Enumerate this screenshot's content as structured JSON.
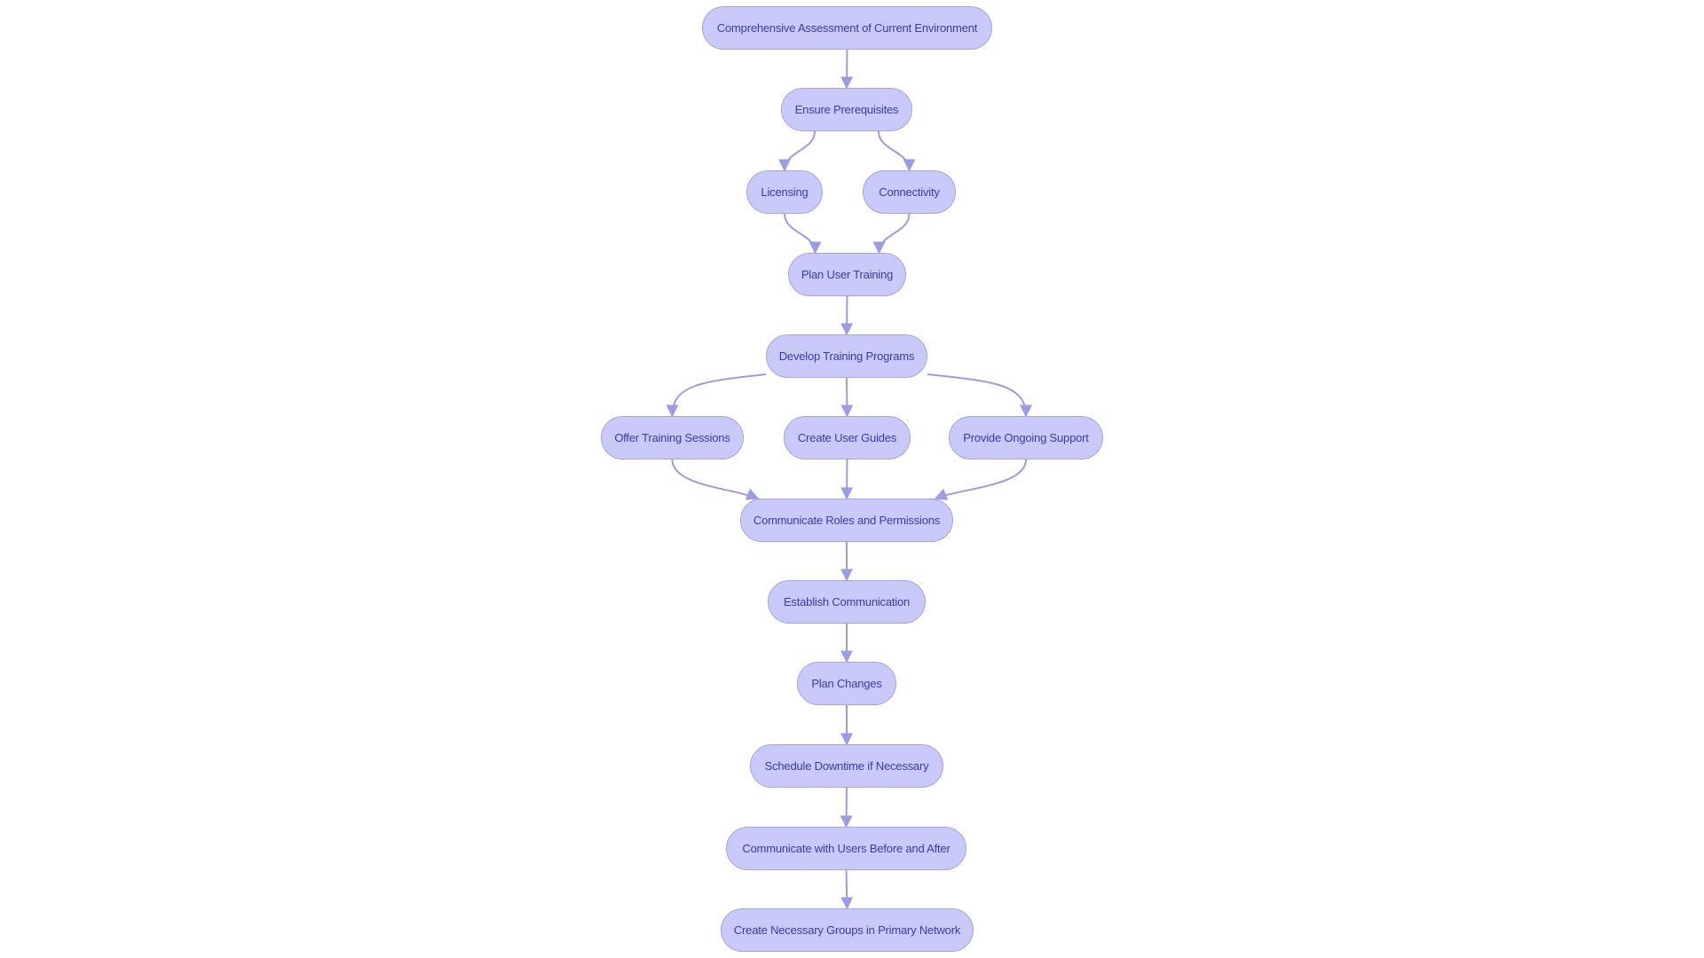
{
  "diagram": {
    "type": "flowchart",
    "direction": "top-to-bottom",
    "colors": {
      "node_fill": "#c9c9fa",
      "node_border": "#a4a4e8",
      "edge": "#9b9be8",
      "text": "#3a3ab0"
    },
    "nodes": [
      {
        "id": "assess",
        "label": "Comprehensive Assessment of Current Environment"
      },
      {
        "id": "prereq",
        "label": "Ensure Prerequisites"
      },
      {
        "id": "licensing",
        "label": "Licensing"
      },
      {
        "id": "connectivity",
        "label": "Connectivity"
      },
      {
        "id": "plan_training",
        "label": "Plan User Training"
      },
      {
        "id": "develop",
        "label": "Develop Training Programs"
      },
      {
        "id": "offer",
        "label": "Offer Training Sessions"
      },
      {
        "id": "guides",
        "label": "Create User Guides"
      },
      {
        "id": "support",
        "label": "Provide Ongoing Support"
      },
      {
        "id": "roles",
        "label": "Communicate Roles and Permissions"
      },
      {
        "id": "establish",
        "label": "Establish Communication"
      },
      {
        "id": "plan_changes",
        "label": "Plan Changes"
      },
      {
        "id": "downtime",
        "label": "Schedule Downtime if Necessary"
      },
      {
        "id": "comm_users",
        "label": "Communicate with Users Before and After"
      },
      {
        "id": "groups",
        "label": "Create Necessary Groups in Primary Network"
      }
    ],
    "edges": [
      [
        "assess",
        "prereq"
      ],
      [
        "prereq",
        "licensing"
      ],
      [
        "prereq",
        "connectivity"
      ],
      [
        "licensing",
        "plan_training"
      ],
      [
        "connectivity",
        "plan_training"
      ],
      [
        "plan_training",
        "develop"
      ],
      [
        "develop",
        "offer"
      ],
      [
        "develop",
        "guides"
      ],
      [
        "develop",
        "support"
      ],
      [
        "offer",
        "roles"
      ],
      [
        "guides",
        "roles"
      ],
      [
        "support",
        "roles"
      ],
      [
        "roles",
        "establish"
      ],
      [
        "establish",
        "plan_changes"
      ],
      [
        "plan_changes",
        "downtime"
      ],
      [
        "downtime",
        "comm_users"
      ],
      [
        "comm_users",
        "groups"
      ]
    ]
  }
}
